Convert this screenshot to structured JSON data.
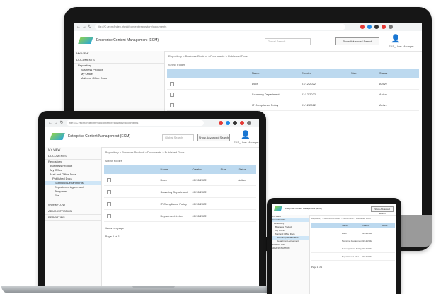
{
  "app": {
    "title": "Enterprise Content Management (ECM)",
    "url": "file:///C:/ecm/index.html#/content/repository/documents"
  },
  "header": {
    "search_placeholder": "Global Search",
    "advanced_search_label": "Show Advanced Search",
    "user_name": "SYS_User Manager"
  },
  "sidebar": {
    "sections": [
      "MY VIEW",
      "DOCUMENTS"
    ],
    "items": [
      "Repository",
      "Business Product",
      "My Office",
      "Mail and Office Docs",
      "Published Docs",
      "Scanning Departments",
      "Department Agreement",
      "Templates",
      "File"
    ],
    "bottom": [
      "WORKFLOW",
      "ADMINISTRATION",
      "REPORTING"
    ]
  },
  "main": {
    "breadcrumb": "Repository > Business Product > Documents > Published Docs",
    "select_label": "Select Folder",
    "columns": [
      "Name",
      "Created",
      "Size",
      "Status"
    ],
    "rows": [
      {
        "name": "Docs",
        "created": "01/12/2022",
        "size": "",
        "status": "Active"
      },
      {
        "name": "Scanning Department",
        "created": "01/12/2022",
        "size": "",
        "status": "Active"
      },
      {
        "name": "IT Compliance Policy",
        "created": "01/12/2022",
        "size": "",
        "status": "Active"
      },
      {
        "name": "Department Letter",
        "created": "01/12/2022",
        "size": "",
        "status": "Active"
      }
    ],
    "footer_label": "Items per page",
    "page_label": "Page 1 of 1"
  },
  "colors": {
    "bezel": "#161616",
    "table_header": "#bcd9ef",
    "selected": "#cfe6f7",
    "logo_start": "#8fd14f",
    "logo_end": "#2ba7d8"
  }
}
